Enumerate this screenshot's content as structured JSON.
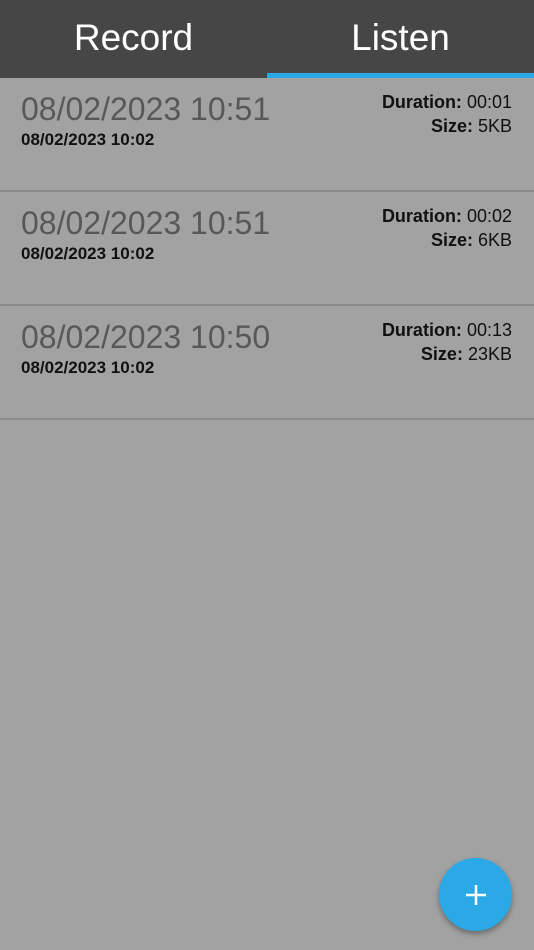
{
  "tabs": [
    {
      "label": "Record",
      "selected": false
    },
    {
      "label": "Listen",
      "selected": true
    }
  ],
  "recordings": [
    {
      "title": "08/02/2023 10:51",
      "subtitle": "08/02/2023 10:02",
      "duration_label": "Duration:",
      "duration": "00:01",
      "size_label": "Size:",
      "size": "5KB"
    },
    {
      "title": "08/02/2023 10:51",
      "subtitle": "08/02/2023 10:02",
      "duration_label": "Duration:",
      "duration": "00:02",
      "size_label": "Size:",
      "size": "6KB"
    },
    {
      "title": "08/02/2023 10:50",
      "subtitle": "08/02/2023 10:02",
      "duration_label": "Duration:",
      "duration": "00:13",
      "size_label": "Size:",
      "size": "23KB"
    }
  ],
  "fab": {
    "icon": "plus-icon"
  },
  "colors": {
    "tabbar": "#464646",
    "accent": "#2aa9e6",
    "background": "#a2a2a2"
  }
}
